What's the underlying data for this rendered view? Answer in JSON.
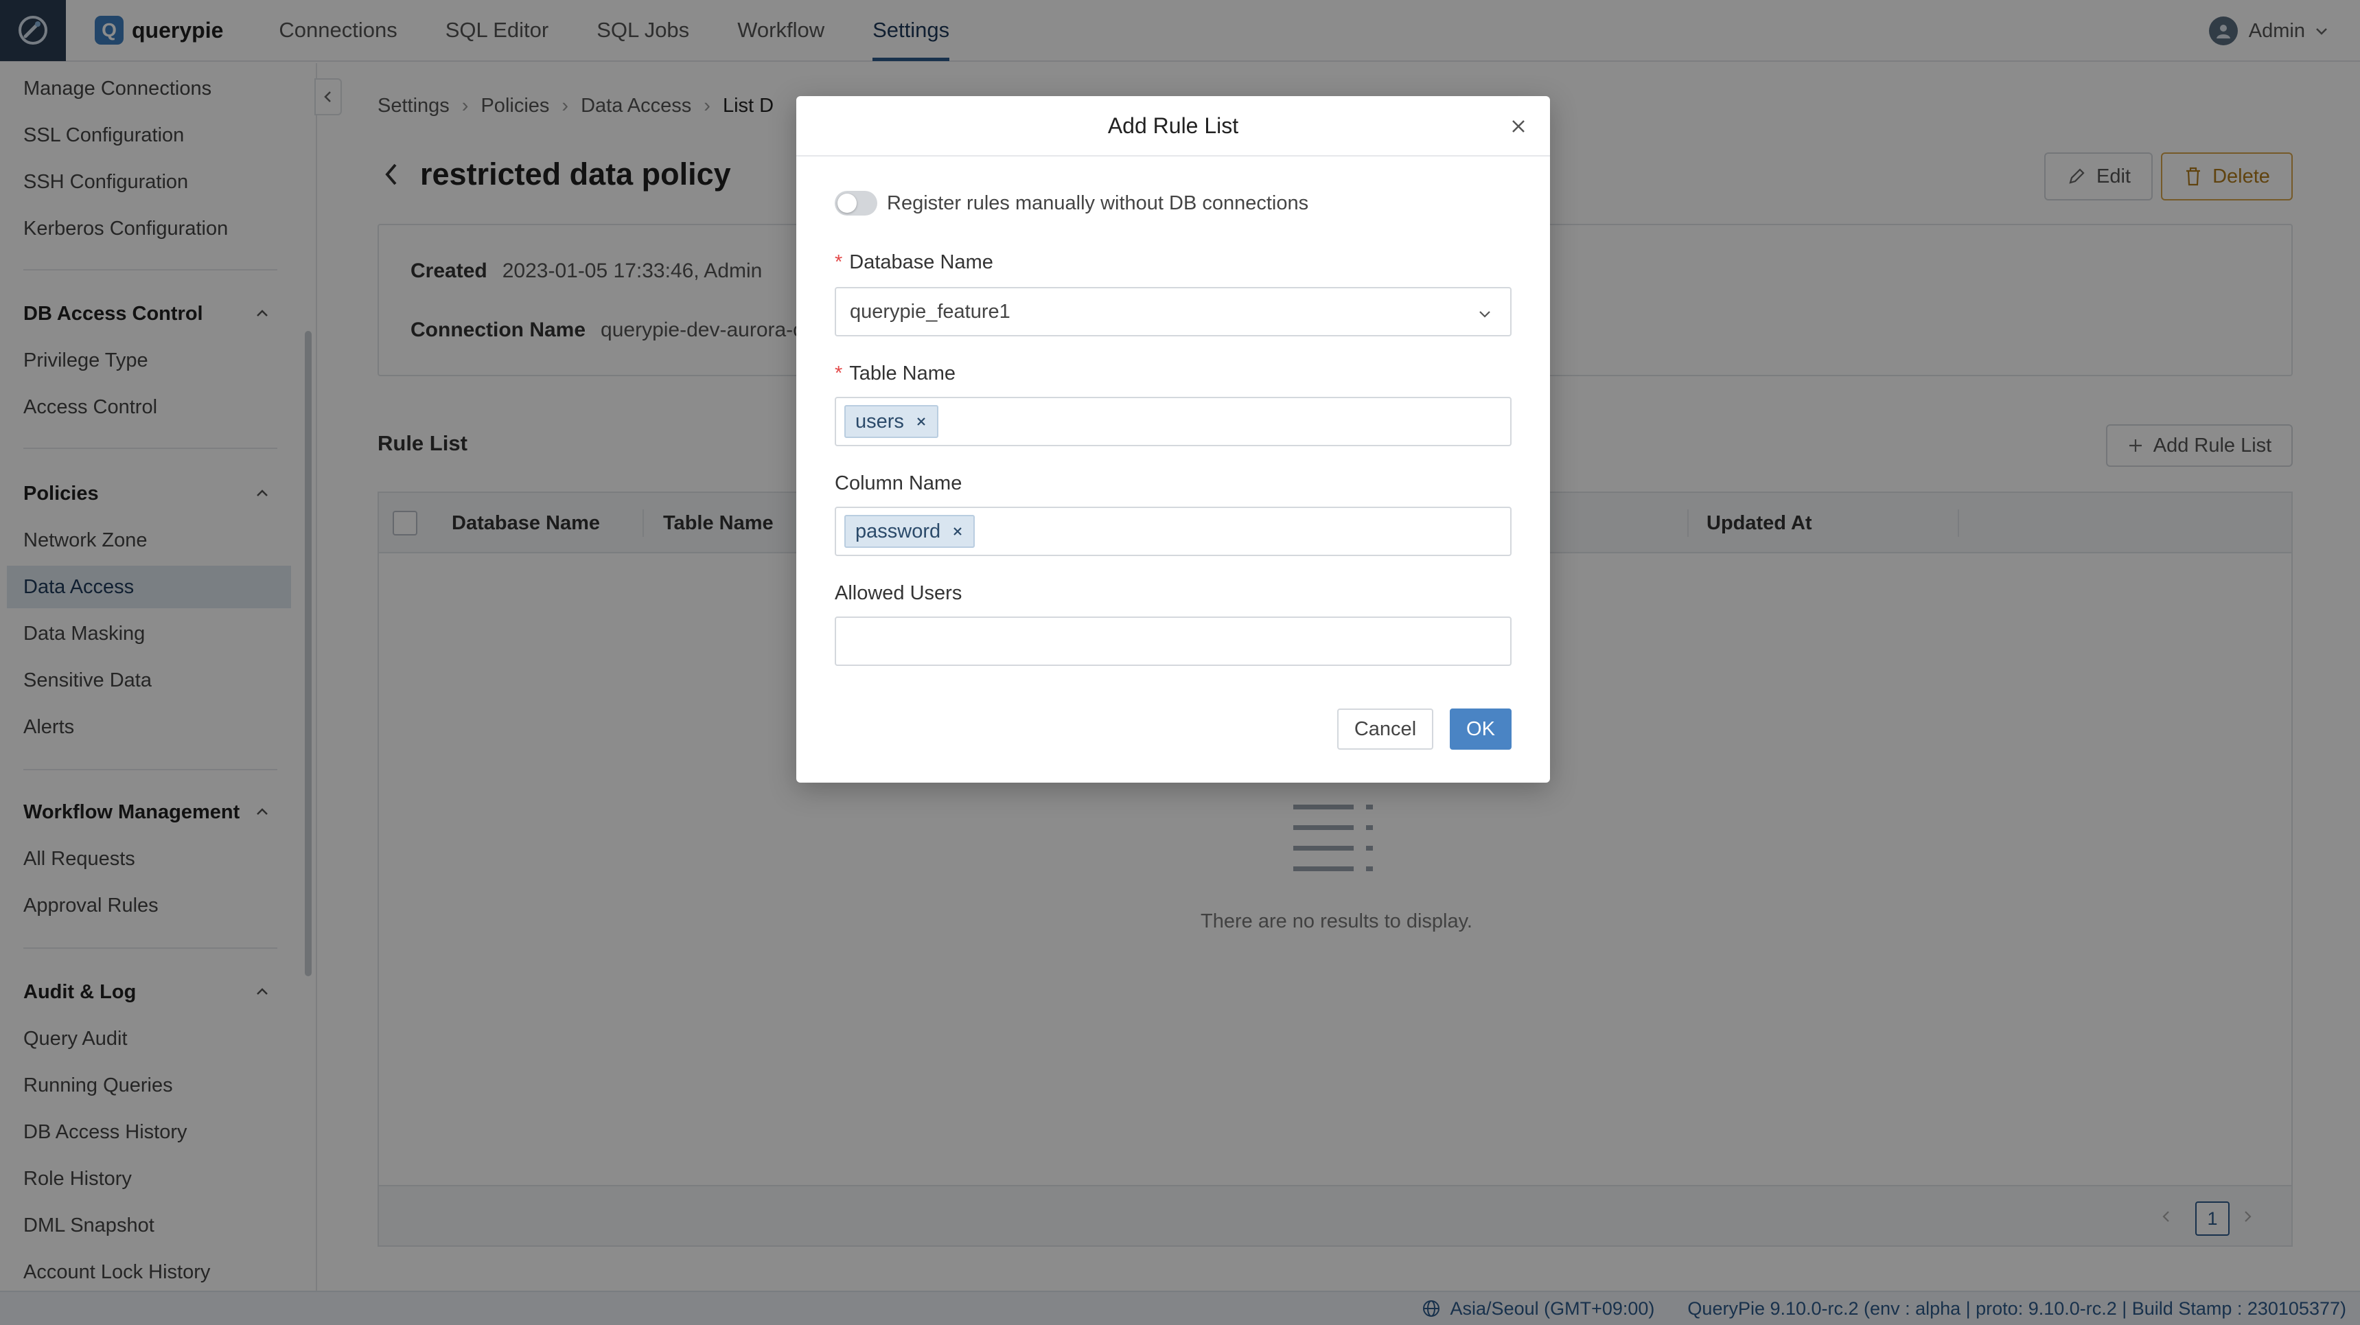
{
  "app": {
    "brand_letter": "Q",
    "brand_name": "querypie"
  },
  "nav": {
    "tabs": [
      "Connections",
      "SQL Editor",
      "SQL Jobs",
      "Workflow",
      "Settings"
    ],
    "active_tab": "Settings",
    "user": "Admin"
  },
  "sidebar": {
    "items_top": [
      "Manage Connections",
      "SSL Configuration",
      "SSH Configuration",
      "Kerberos Configuration"
    ],
    "groups": [
      {
        "title": "DB Access Control",
        "items": [
          "Privilege Type",
          "Access Control"
        ]
      },
      {
        "title": "Policies",
        "items": [
          "Network Zone",
          "Data Access",
          "Data Masking",
          "Sensitive Data",
          "Alerts"
        ]
      },
      {
        "title": "Workflow Management",
        "items": [
          "All Requests",
          "Approval Rules"
        ]
      },
      {
        "title": "Audit & Log",
        "items": [
          "Query Audit",
          "Running Queries",
          "DB Access History",
          "Role History",
          "DML Snapshot",
          "Account Lock History"
        ]
      }
    ],
    "active_item": "Data Access"
  },
  "breadcrumb": [
    "Settings",
    "Policies",
    "Data Access",
    "List D"
  ],
  "page": {
    "title": "restricted data policy",
    "edit_label": "Edit",
    "delete_label": "Delete",
    "created_label": "Created",
    "created_value": "2023-01-05 17:33:46, Admin",
    "connection_label": "Connection Name",
    "connection_value": "querypie-dev-aurora-c"
  },
  "rule_list": {
    "title": "Rule List",
    "add_label": "Add Rule List",
    "columns": [
      "Database Name",
      "Table Name",
      "Updated At"
    ],
    "empty_text": "There are no results to display.",
    "page": "1"
  },
  "status_bar": {
    "timezone": "Asia/Seoul (GMT+09:00)",
    "version": "QueryPie 9.10.0-rc.2 (env : alpha | proto: 9.10.0-rc.2 | Build Stamp : 230105377)"
  },
  "modal": {
    "title": "Add Rule List",
    "toggle_label": "Register rules manually without DB connections",
    "toggle_on": false,
    "database_label": "Database Name",
    "database_value": "querypie_feature1",
    "table_label": "Table Name",
    "table_tags": [
      "users"
    ],
    "column_label": "Column Name",
    "column_tags": [
      "password"
    ],
    "users_label": "Allowed Users",
    "users_value": "",
    "required_mark": "*",
    "cancel_label": "Cancel",
    "ok_label": "OK"
  },
  "colors": {
    "accent": "#2d5a8a",
    "primary_button": "#4a84c4",
    "delete": "#b07a1c",
    "tag_bg": "#d9e5f0"
  }
}
